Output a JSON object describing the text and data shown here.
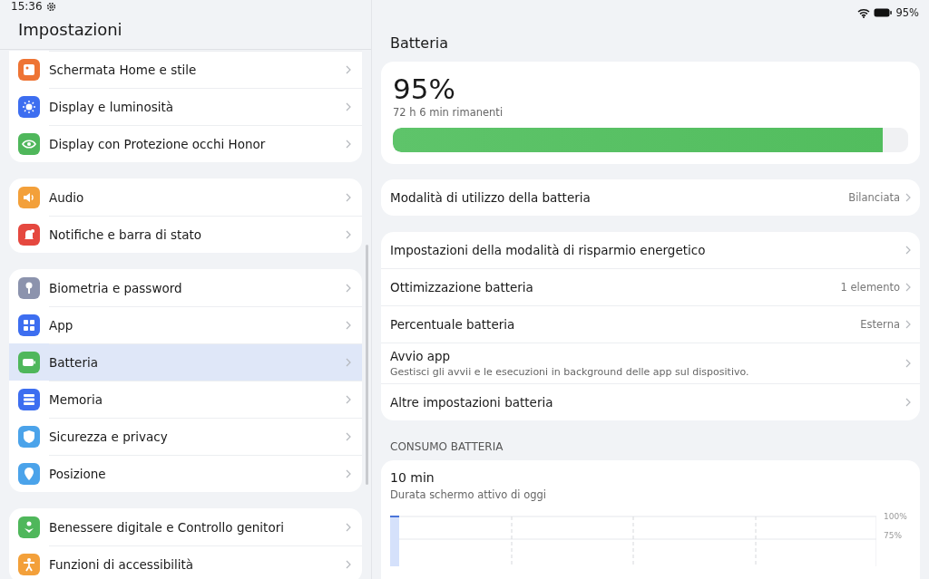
{
  "status_bar": {
    "time": "15:36",
    "battery": "95%"
  },
  "sidebar": {
    "title": "Impostazioni",
    "groups": [
      [
        {
          "label": "Schermata Home e stile",
          "color": "#ee7434",
          "selected": false
        },
        {
          "label": "Display e luminosità",
          "color": "#3d6ef0",
          "selected": false
        },
        {
          "label": "Display con Protezione occhi Honor",
          "color": "#4fb75b",
          "selected": false
        }
      ],
      [
        {
          "label": "Audio",
          "color": "#f3a03a",
          "selected": false
        },
        {
          "label": "Notifiche e barra di stato",
          "color": "#e5483f",
          "selected": false
        }
      ],
      [
        {
          "label": "Biometria e password",
          "color": "#8c93ad",
          "selected": false
        },
        {
          "label": "App",
          "color": "#3d6ef0",
          "selected": false
        },
        {
          "label": "Batteria",
          "color": "#4fb75b",
          "selected": true
        },
        {
          "label": "Memoria",
          "color": "#3d6ef0",
          "selected": false
        },
        {
          "label": "Sicurezza e privacy",
          "color": "#4ba3ea",
          "selected": false
        },
        {
          "label": "Posizione",
          "color": "#4ba3ea",
          "selected": false
        }
      ],
      [
        {
          "label": "Benessere digitale e Controllo genitori",
          "color": "#4fb75b",
          "selected": false
        },
        {
          "label": "Funzioni di accessibilità",
          "color": "#f3a03a",
          "selected": false
        }
      ]
    ]
  },
  "detail": {
    "title": "Batteria",
    "battery": {
      "percent": "95%",
      "remaining": "72 h 6 min rimanenti",
      "level": 0.95
    },
    "mode_row": {
      "label": "Modalità di utilizzo della batteria",
      "value": "Bilanciata"
    },
    "settings": [
      {
        "label": "Impostazioni della modalità di risparmio energetico"
      },
      {
        "label": "Ottimizzazione batteria",
        "value": "1 elemento"
      },
      {
        "label": "Percentuale batteria",
        "value": "Esterna"
      },
      {
        "label": "Avvio app",
        "subtitle": "Gestisci gli avvii e le esecuzioni in background delle app sul dispositivo."
      },
      {
        "label": "Altre impostazioni batteria"
      }
    ],
    "section_title": "CONSUMO BATTERIA",
    "usage": {
      "value": "10 min",
      "caption": "Durata schermo attivo di oggi",
      "axis_labels": [
        "100%",
        "75%"
      ]
    }
  }
}
